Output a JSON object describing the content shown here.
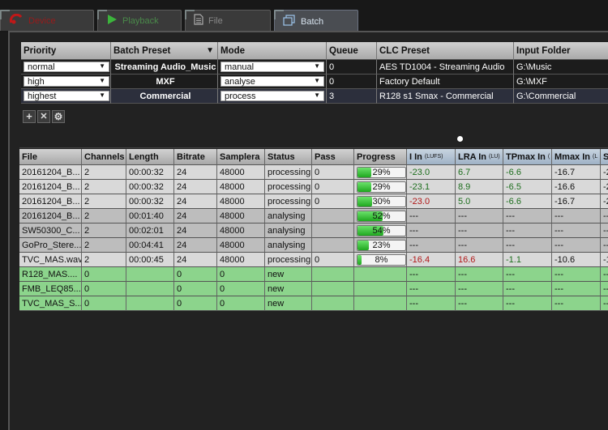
{
  "tabs": [
    {
      "label": "Device",
      "icon": "device-icon",
      "active": false
    },
    {
      "label": "Playback",
      "icon": "play-icon",
      "active": false
    },
    {
      "label": "File",
      "icon": "file-icon",
      "active": false
    },
    {
      "label": "Batch",
      "icon": "batch-icon",
      "active": true
    }
  ],
  "presets": {
    "headers": {
      "priority": "Priority",
      "batch_preset": "Batch Preset",
      "mode": "Mode",
      "queue": "Queue",
      "clc_preset": "CLC Preset",
      "input_folder": "Input Folder"
    },
    "rows": [
      {
        "priority": "normal",
        "batch_preset": "Streaming Audio_Music",
        "mode": "manual",
        "queue": "0",
        "clc_preset": "AES TD1004 - Streaming Audio",
        "input_folder": "G:\\Music"
      },
      {
        "priority": "high",
        "batch_preset": "MXF",
        "mode": "analyse",
        "queue": "0",
        "clc_preset": "Factory Default",
        "input_folder": "G:\\MXF"
      },
      {
        "priority": "highest",
        "batch_preset": "Commercial",
        "mode": "process",
        "queue": "3",
        "clc_preset": "R128 s1 Smax - Commercial",
        "input_folder": "G:\\Commercial"
      }
    ],
    "tools": {
      "add": "+",
      "remove": "✕",
      "settings": "⚙"
    }
  },
  "files": {
    "headers": {
      "file": "File",
      "channels": "Channels",
      "length": "Length",
      "bitrate": "Bitrate",
      "samplerate": "Samplera",
      "status": "Status",
      "pass": "Pass",
      "progress": "Progress",
      "i_in": "I In",
      "i_in_unit": "(LUFS)",
      "lra_in": "LRA In",
      "lra_in_unit": "(LU)",
      "tpmax_in": "TPmax In",
      "tpmax_unit": "(",
      "mmax_in": "Mmax In",
      "mmax_unit": "(L",
      "s": "S"
    },
    "rows": [
      {
        "file": "20161204_B...",
        "channels": "2",
        "length": "00:00:32",
        "bitrate": "24",
        "samplerate": "48000",
        "status": "processing",
        "pass": "0",
        "progress": 29,
        "progress_label": "29%",
        "i_in": "-23.0",
        "lra_in": "6.7",
        "tpmax_in": "-6.6",
        "mmax_in": "-16.7",
        "s": "-2",
        "type": "g"
      },
      {
        "file": "20161204_B...",
        "channels": "2",
        "length": "00:00:32",
        "bitrate": "24",
        "samplerate": "48000",
        "status": "processing",
        "pass": "0",
        "progress": 29,
        "progress_label": "29%",
        "i_in": "-23.1",
        "lra_in": "8.9",
        "tpmax_in": "-6.5",
        "mmax_in": "-16.6",
        "s": "-2",
        "type": "g"
      },
      {
        "file": "20161204_B...",
        "channels": "2",
        "length": "00:00:32",
        "bitrate": "24",
        "samplerate": "48000",
        "status": "processing",
        "pass": "0",
        "progress": 30,
        "progress_label": "30%",
        "i_in": "-23.0",
        "lra_in": "5.0",
        "tpmax_in": "-6.6",
        "mmax_in": "-16.7",
        "s": "-2",
        "type": "g"
      },
      {
        "file": "20161204_B...",
        "channels": "2",
        "length": "00:01:40",
        "bitrate": "24",
        "samplerate": "48000",
        "status": "analysing",
        "pass": "",
        "progress": 52,
        "progress_label": "52%",
        "i_in": "---",
        "lra_in": "---",
        "tpmax_in": "---",
        "mmax_in": "---",
        "s": "--",
        "type": "d"
      },
      {
        "file": "SW50300_C...",
        "channels": "2",
        "length": "00:02:01",
        "bitrate": "24",
        "samplerate": "48000",
        "status": "analysing",
        "pass": "",
        "progress": 54,
        "progress_label": "54%",
        "i_in": "---",
        "lra_in": "---",
        "tpmax_in": "---",
        "mmax_in": "---",
        "s": "--",
        "type": "d"
      },
      {
        "file": "GoPro_Stere...",
        "channels": "2",
        "length": "00:04:41",
        "bitrate": "24",
        "samplerate": "48000",
        "status": "analysing",
        "pass": "",
        "progress": 23,
        "progress_label": "23%",
        "i_in": "---",
        "lra_in": "---",
        "tpmax_in": "---",
        "mmax_in": "---",
        "s": "--",
        "type": "d"
      },
      {
        "file": "TVC_MAS.wav",
        "channels": "2",
        "length": "00:00:45",
        "bitrate": "24",
        "samplerate": "48000",
        "status": "processing",
        "pass": "0",
        "progress": 8,
        "progress_label": "8%",
        "i_in": "-16.4",
        "lra_in": "16.6",
        "tpmax_in": "-1.1",
        "mmax_in": "-10.6",
        "s": "-1",
        "type": "g"
      },
      {
        "file": "R128_MAS....",
        "channels": "0",
        "length": "",
        "bitrate": "0",
        "samplerate": "0",
        "status": "new",
        "pass": "",
        "progress": null,
        "progress_label": "",
        "i_in": "---",
        "lra_in": "---",
        "tpmax_in": "---",
        "mmax_in": "---",
        "s": "--",
        "type": "n"
      },
      {
        "file": "FMB_LEQ85....",
        "channels": "0",
        "length": "",
        "bitrate": "0",
        "samplerate": "0",
        "status": "new",
        "pass": "",
        "progress": null,
        "progress_label": "",
        "i_in": "---",
        "lra_in": "---",
        "tpmax_in": "---",
        "mmax_in": "---",
        "s": "--",
        "type": "n"
      },
      {
        "file": "TVC_MAS_S...",
        "channels": "0",
        "length": "",
        "bitrate": "0",
        "samplerate": "0",
        "status": "new",
        "pass": "",
        "progress": null,
        "progress_label": "",
        "i_in": "---",
        "lra_in": "---",
        "tpmax_in": "---",
        "mmax_in": "---",
        "s": "--",
        "type": "n"
      }
    ]
  }
}
